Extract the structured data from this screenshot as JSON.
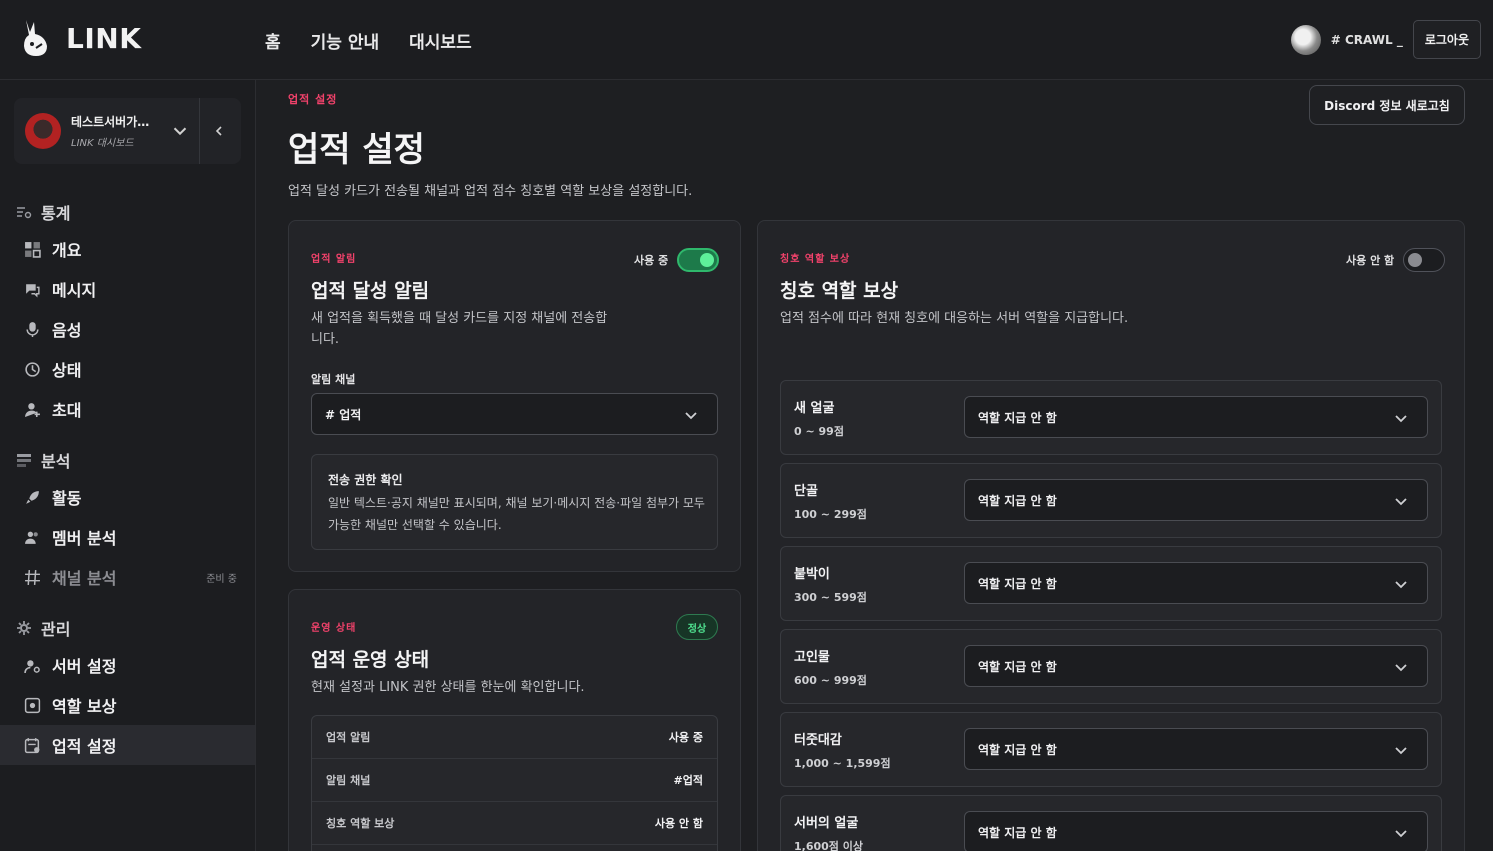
{
  "header": {
    "brand": "LINK",
    "nav": [
      "홈",
      "기능 안내",
      "대시보드"
    ],
    "username": "# CRAWL _",
    "logout": "로그아웃"
  },
  "sidebar": {
    "server_name": "테스트서버가…",
    "server_sub": "LINK 대시보드",
    "sections": [
      {
        "title": "통계",
        "icon": "stats-icon"
      },
      {
        "title": "분석",
        "icon": "analysis-icon"
      },
      {
        "title": "관리",
        "icon": "gear-icon"
      }
    ],
    "items": [
      {
        "label": "개요",
        "icon": "overview-icon"
      },
      {
        "label": "메시지",
        "icon": "message-icon"
      },
      {
        "label": "음성",
        "icon": "mic-icon"
      },
      {
        "label": "상태",
        "icon": "status-icon"
      },
      {
        "label": "초대",
        "icon": "invite-icon"
      },
      {
        "label": "활동",
        "icon": "rocket-icon"
      },
      {
        "label": "멤버 분석",
        "icon": "members-icon"
      },
      {
        "label": "채널 분석",
        "icon": "hash-icon",
        "tag": "준비 중"
      },
      {
        "label": "서버 설정",
        "icon": "server-settings-icon"
      },
      {
        "label": "역할 보상",
        "icon": "role-reward-icon"
      },
      {
        "label": "업적 설정",
        "icon": "achievement-icon"
      }
    ]
  },
  "page": {
    "eyebrow": "업적 설정",
    "title": "업적 설정",
    "description": "업적 달성 카드가 전송될 채널과 업적 점수 칭호별 역할 보상을 설정합니다.",
    "refresh_button": "Discord 정보 새로고침"
  },
  "notify_card": {
    "eyebrow": "업적 알림",
    "title": "업적 달성 알림",
    "description": "새 업적을 획득했을 때 달성 카드를 지정 채널에 전송합니다.",
    "toggle_label": "사용 중",
    "toggle_on": true,
    "channel_label": "알림 채널",
    "channel_value": "# 업적",
    "notice_title": "전송 권한 확인",
    "notice_text": "일반 텍스트·공지 채널만 표시되며, 채널 보기·메시지 전송·파일 첨부가 모두 가능한 채널만 선택할 수 있습니다."
  },
  "status_card": {
    "eyebrow": "운영 상태",
    "title": "업적 운영 상태",
    "description": "현재 설정과 LINK 권한 상태를 한눈에 확인합니다.",
    "badge": "정상",
    "rows": [
      {
        "key": "업적 알림",
        "value": "사용 중"
      },
      {
        "key": "알림 채널",
        "value": "#업적"
      },
      {
        "key": "칭호 역할 보상",
        "value": "사용 안 함"
      }
    ]
  },
  "reward_card": {
    "eyebrow": "칭호 역할 보상",
    "title": "칭호 역할 보상",
    "description": "업적 점수에 따라 현재 칭호에 대응하는 서버 역할을 지급합니다.",
    "toggle_label": "사용 안 함",
    "toggle_on": false,
    "tiers": [
      {
        "name": "새 얼굴",
        "range": "0 ~ 99점",
        "role": "역할 지급 안 함"
      },
      {
        "name": "단골",
        "range": "100 ~ 299점",
        "role": "역할 지급 안 함"
      },
      {
        "name": "붙박이",
        "range": "300 ~ 599점",
        "role": "역할 지급 안 함"
      },
      {
        "name": "고인물",
        "range": "600 ~ 999점",
        "role": "역할 지급 안 함"
      },
      {
        "name": "터줏대감",
        "range": "1,000 ~ 1,599점",
        "role": "역할 지급 안 함"
      },
      {
        "name": "서버의 얼굴",
        "range": "1,600점 이상",
        "role": "역할 지급 안 함"
      }
    ]
  },
  "colors": {
    "accent_pink": "#f2426b",
    "toggle_on": "#2fb86c",
    "status_ok": "#4fe08f"
  }
}
